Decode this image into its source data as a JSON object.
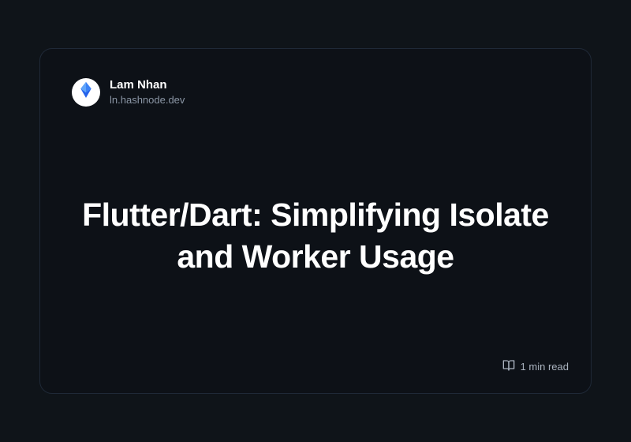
{
  "author": {
    "name": "Lam Nhan",
    "domain": "ln.hashnode.dev"
  },
  "post": {
    "title": "Flutter/Dart: Simplifying Isolate and Worker Usage",
    "read_time": "1 min read"
  },
  "colors": {
    "surface": "#0d1117",
    "background": "#0f1419",
    "text_primary": "#ffffff",
    "text_secondary": "#8b96a5",
    "accent": "#2563eb"
  }
}
